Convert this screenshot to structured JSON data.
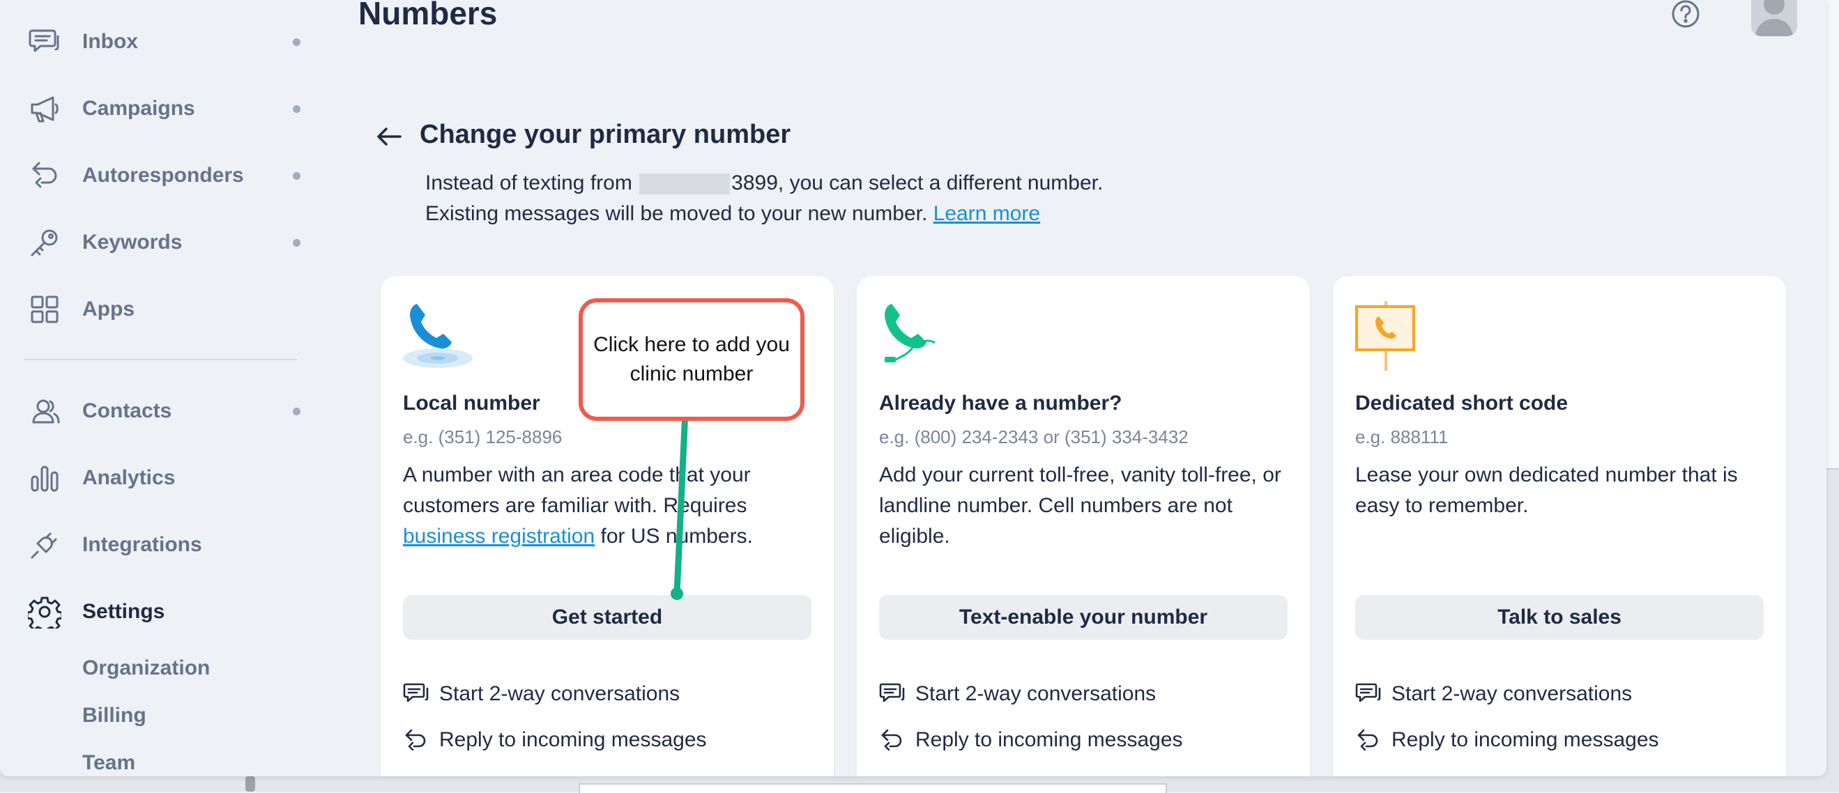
{
  "sidebar": {
    "items": [
      {
        "label": "Inbox",
        "icon": "chat-bubbles-icon"
      },
      {
        "label": "Campaigns",
        "icon": "megaphone-icon"
      },
      {
        "label": "Autoresponders",
        "icon": "reply-arrows-icon"
      },
      {
        "label": "Keywords",
        "icon": "key-icon"
      },
      {
        "label": "Apps",
        "icon": "grid-icon"
      },
      {
        "label": "Contacts",
        "icon": "contacts-icon"
      },
      {
        "label": "Analytics",
        "icon": "bar-chart-icon"
      },
      {
        "label": "Integrations",
        "icon": "plug-icon"
      },
      {
        "label": "Settings",
        "icon": "gear-icon"
      }
    ],
    "subitems": [
      {
        "label": "Organization"
      },
      {
        "label": "Billing"
      },
      {
        "label": "Team"
      }
    ]
  },
  "header": {
    "title": "Numbers"
  },
  "section": {
    "title": "Change your primary number",
    "desc_line1_prefix": "Instead of texting from",
    "desc_line1_suffix": "3899, you can select a different number.",
    "desc_line2": "Existing messages will be moved to your new number.",
    "learn_more": "Learn more"
  },
  "cards": [
    {
      "title": "Local number",
      "example": "e.g. (351) 125-8896",
      "desc_prefix": "A number with an area code that your customers are familiar with. Requires",
      "desc_link": "business registration",
      "desc_suffix": "for US numbers.",
      "button": "Get started",
      "features": [
        "Start 2-way conversations",
        "Reply to incoming messages"
      ]
    },
    {
      "title": "Already have a number?",
      "example": "e.g. (800) 234-2343 or (351) 334-3432",
      "desc": "Add your current toll-free, vanity toll-free, or landline number. Cell numbers are not eligible.",
      "button": "Text-enable your number",
      "features": [
        "Start 2-way conversations",
        "Reply to incoming messages"
      ]
    },
    {
      "title": "Dedicated short code",
      "example": "e.g. 888111",
      "desc": "Lease your own dedicated number that is easy to remember.",
      "button": "Talk to sales",
      "features": [
        "Start 2-way conversations",
        "Reply to incoming messages"
      ]
    }
  ],
  "annotation": {
    "text": "Click here to add you clinic number"
  },
  "colors": {
    "accent_link": "#1a8fd6",
    "annotation_border": "#ef5a4f",
    "annotation_arrow": "#13b08a",
    "phone_blue": "#1a8fd6",
    "phone_green": "#13c28b",
    "phone_orange": "#f5a623"
  }
}
